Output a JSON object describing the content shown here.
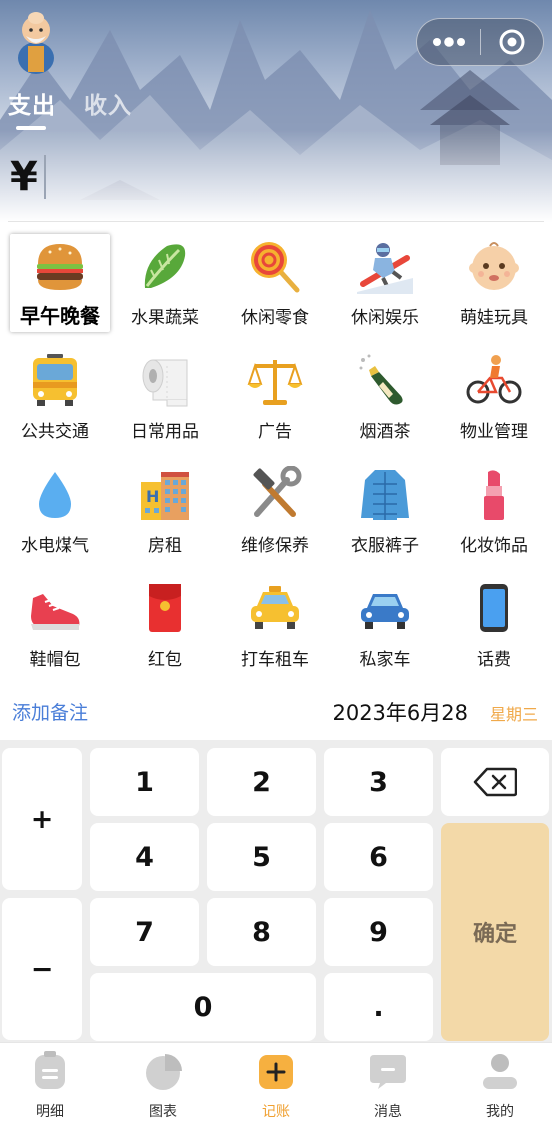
{
  "header": {
    "tabs": [
      {
        "label": "支出",
        "active": true
      },
      {
        "label": "收入",
        "active": false
      }
    ],
    "currency_symbol": "¥",
    "amount": "",
    "capsule": {
      "more_icon": "more-dots-icon",
      "close_icon": "target-circle-icon"
    }
  },
  "categories": [
    {
      "label": "早午晚餐",
      "icon": "hamburger-icon",
      "selected": true
    },
    {
      "label": "水果蔬菜",
      "icon": "leafy-greens-icon"
    },
    {
      "label": "休闲零食",
      "icon": "lollipop-icon"
    },
    {
      "label": "休闲娱乐",
      "icon": "snowboarder-icon"
    },
    {
      "label": "萌娃玩具",
      "icon": "baby-face-icon"
    },
    {
      "label": "公共交通",
      "icon": "bus-icon"
    },
    {
      "label": "日常用品",
      "icon": "paper-roll-icon"
    },
    {
      "label": "广告",
      "icon": "balance-scale-icon"
    },
    {
      "label": "烟酒茶",
      "icon": "champagne-bottle-icon"
    },
    {
      "label": "物业管理",
      "icon": "cyclist-icon"
    },
    {
      "label": "水电煤气",
      "icon": "water-drop-icon"
    },
    {
      "label": "房租",
      "icon": "hotel-building-icon"
    },
    {
      "label": "维修保养",
      "icon": "hammer-wrench-icon"
    },
    {
      "label": "衣服裤子",
      "icon": "puffer-jacket-icon"
    },
    {
      "label": "化妆饰品",
      "icon": "lipstick-icon"
    },
    {
      "label": "鞋帽包",
      "icon": "sneaker-icon"
    },
    {
      "label": "红包",
      "icon": "red-envelope-icon"
    },
    {
      "label": "打车租车",
      "icon": "taxi-icon"
    },
    {
      "label": "私家车",
      "icon": "car-icon"
    },
    {
      "label": "话费",
      "icon": "mobile-phone-icon"
    }
  ],
  "note": {
    "label": "添加备注"
  },
  "date": {
    "text": "2023年6月28",
    "weekday": "星期三"
  },
  "keypad": {
    "plus": "+",
    "minus": "−",
    "digits": [
      "1",
      "2",
      "3",
      "4",
      "5",
      "6",
      "7",
      "8",
      "9",
      "0",
      "."
    ],
    "backspace_icon": "backspace-icon",
    "confirm": "确定"
  },
  "nav": [
    {
      "label": "明细",
      "icon": "clipboard-icon"
    },
    {
      "label": "图表",
      "icon": "pie-chart-icon"
    },
    {
      "label": "记账",
      "icon": "add-square-icon",
      "active": true
    },
    {
      "label": "消息",
      "icon": "message-icon"
    },
    {
      "label": "我的",
      "icon": "person-icon"
    }
  ],
  "colors": {
    "accent": "#f0a030",
    "confirm_bg": "#f3d9a8",
    "link": "#4a7ed8",
    "weekday": "#f0a94a",
    "keypad_bg": "#ededed"
  }
}
